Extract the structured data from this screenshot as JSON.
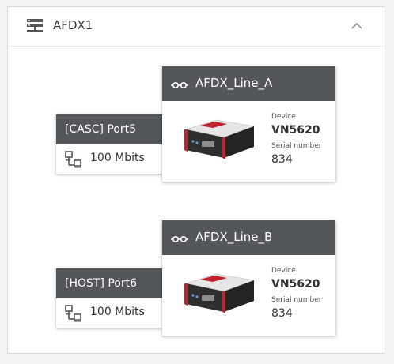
{
  "header": {
    "title": "AFDX1",
    "icon": "server-icon",
    "collapse_icon": "chevron-up-icon"
  },
  "ports": [
    {
      "name": "[CASC] Port5",
      "speed": "100 Mbits",
      "icon": "network-icon"
    },
    {
      "name": "[HOST] Port6",
      "speed": "100 Mbits",
      "icon": "network-icon"
    }
  ],
  "lines": [
    {
      "title": "AFDX_Line_A",
      "icon": "link-icon",
      "device_label": "Device",
      "device": "VN5620",
      "serial_label": "Serial number",
      "serial": "834"
    },
    {
      "title": "AFDX_Line_B",
      "icon": "link-icon",
      "device_label": "Device",
      "device": "VN5620",
      "serial_label": "Serial number",
      "serial": "834"
    }
  ],
  "colors": {
    "card_header": "#535759",
    "background": "#f3f3f3",
    "device_accent": "#c0232c"
  }
}
